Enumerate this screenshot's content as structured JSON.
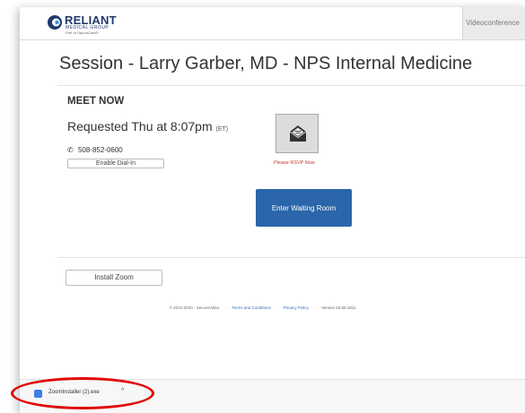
{
  "header": {
    "logo_name": "RELIANT",
    "logo_sub": "MEDICAL GROUP",
    "logo_part": "Part of OptumCare®",
    "tab_label": "Videoconference"
  },
  "session": {
    "title": "Session - Larry Garber, MD - NPS Internal Medicine"
  },
  "meet": {
    "heading": "MEET NOW",
    "requested": "Requested Thu at 8:07pm",
    "timezone": "(ET)",
    "phone_icon": "phone-icon",
    "phone": "508-852-0600",
    "dial_in_label": "Enable Dial-In",
    "rsvp_icon": "envelope-icon",
    "rsvp_label": "Please RSVP Now",
    "enter_label": "Enter Waiting Room"
  },
  "install_label": "Install Zoom",
  "footer": {
    "copyright": "© 2012-2020 - SecureVideo",
    "sep": "-",
    "terms": "Terms and Conditions",
    "privacy": "Privacy Policy",
    "version": "Version 10.85.1911"
  },
  "download": {
    "icon": "zoom-installer-icon",
    "filename": "ZoomInstaller (2).exe",
    "chevron": "^"
  },
  "colors": {
    "accent_button": "#2a66a9",
    "rsvp_text": "#c0392b",
    "highlight_ellipse": "#e00000",
    "link": "#3a6bb0"
  }
}
